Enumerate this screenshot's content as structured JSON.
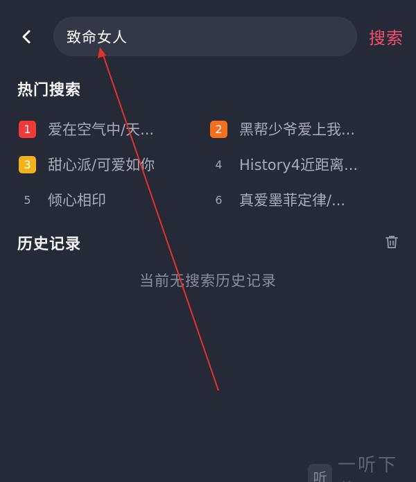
{
  "header": {
    "search_value": "致命女人",
    "search_label": "搜索"
  },
  "hot": {
    "title": "热门搜索",
    "items": [
      {
        "rank": "1",
        "text": "爱在空气中/天...",
        "color": "#f03a3a"
      },
      {
        "rank": "2",
        "text": "黑帮少爷爱上我...",
        "color": "#f2701e"
      },
      {
        "rank": "3",
        "text": "甜心派/可爱如你",
        "color": "#f2b31a"
      },
      {
        "rank": "4",
        "text": "History4近距离..."
      },
      {
        "rank": "5",
        "text": "倾心相印"
      },
      {
        "rank": "6",
        "text": "真爱墨菲定律/..."
      }
    ]
  },
  "history": {
    "title": "历史记录",
    "empty_text": "当前无搜索历史记录"
  },
  "watermark": {
    "logo": "听",
    "text": "一听下载"
  },
  "icons": {
    "back": "chevron-left-icon",
    "trash": "trash-icon"
  },
  "colors": {
    "background": "#262a37",
    "accent": "#f14d6d",
    "annotation_arrow": "#e0332b"
  }
}
